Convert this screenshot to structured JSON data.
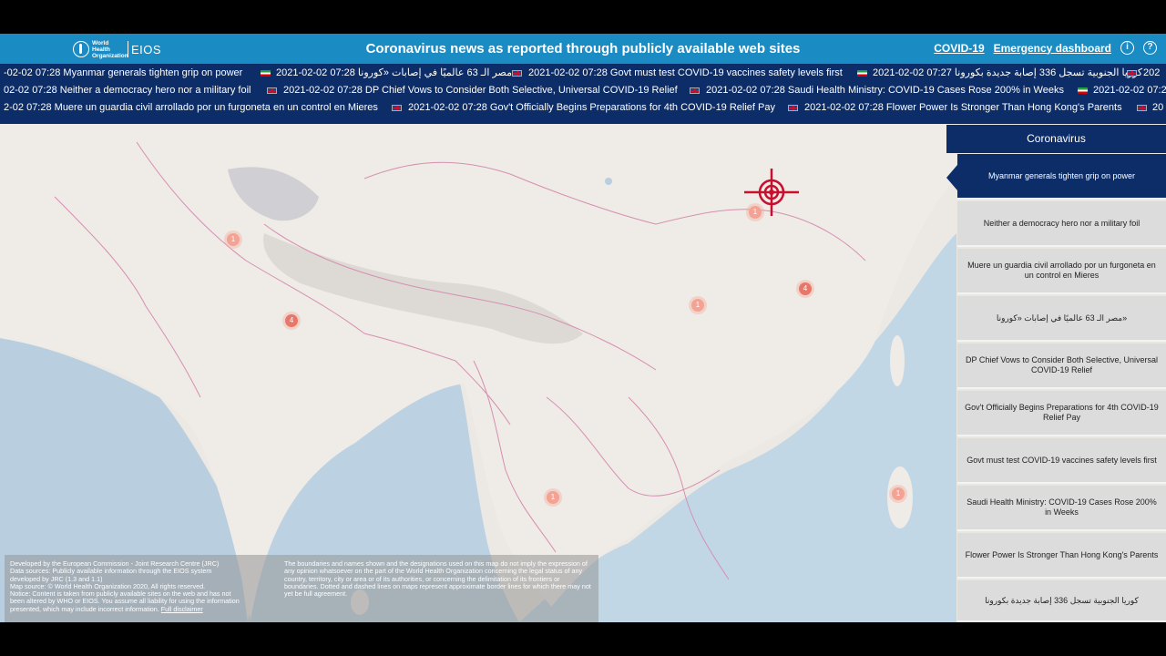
{
  "header": {
    "logo_org": "World Health Organization",
    "logo_product": "EIOS",
    "title": "Coronavirus news as reported through publicly available web sites",
    "nav_covid": "COVID-19",
    "nav_dashboard": "Emergency dashboard",
    "info_icon": "info-icon",
    "help_icon": "help-icon",
    "info_glyph": "i",
    "help_glyph": "?"
  },
  "ticker": {
    "rows": [
      [
        {
          "text": "-02-02 07:28  Myanmar generals tighten grip on power"
        },
        {
          "text": "2021-02-02 07:28  مصر الـ 63 عالميًا في إصابات «كورونا»"
        },
        {
          "text": "2021-02-02 07:28  Govt must test COVID-19 vaccines safety levels first"
        },
        {
          "text": "2021-02-02 07:27  كوريا الجنوبية تسجل 336 إصابة جديدة بكورونا"
        },
        {
          "text": "202"
        }
      ],
      [
        {
          "text": "02-02 07:28  Neither a democracy hero nor a military foil"
        },
        {
          "text": "2021-02-02 07:28  DP Chief Vows to Consider Both Selective, Universal COVID-19 Relief"
        },
        {
          "text": "2021-02-02 07:28  Saudi Health Ministry: COVID-19 Cases Rose 200% in Weeks"
        },
        {
          "text": "2021-02-02 07:2"
        }
      ],
      [
        {
          "text": "2-02 07:28  Muere un guardia civil arrollado por un furgoneta en un control en Mieres"
        },
        {
          "text": "2021-02-02 07:28  Gov't Officially Begins Preparations for 4th COVID-19 Relief Pay"
        },
        {
          "text": "2021-02-02 07:28  Flower Power Is Stronger Than Hong Kong's Parents"
        },
        {
          "text": "20"
        }
      ]
    ]
  },
  "map": {
    "clusters": [
      {
        "label": "1"
      },
      {
        "label": "4"
      },
      {
        "label": "1"
      },
      {
        "label": "4"
      },
      {
        "label": "1"
      },
      {
        "label": "1"
      },
      {
        "label": "1"
      }
    ],
    "target_icon": "crosshair-target-icon"
  },
  "footer": {
    "left_lines": [
      "Developed by the European Commission - Joint Research Centre (JRC)",
      "Data sources: Publicly available information through the EIOS system",
      "developed by JRC (1.3 and 1.1)",
      "Map source: © World Health Organization 2020, All rights reserved.",
      "Notice: Content is taken from publicly available sites on the web and has not",
      "been altered by WHO or EIOS. You assume all liability for using the information",
      "presented, which may include incorrect information."
    ],
    "disclaimer_link": "Full disclaimer",
    "right_text": "The boundaries and names shown and the designations used on this map do not imply the expression of any opinion whatsoever on the part of the World Health Organization concerning the legal status of any country, territory, city or area or of its authorities, or concerning the delimitation of its frontiers or boundaries. Dotted and dashed lines on maps represent approximate border lines for which there may not yet be full agreement."
  },
  "sidebar": {
    "title": "Coronavirus",
    "items": [
      {
        "label": "Myanmar generals tighten grip on power"
      },
      {
        "label": "Neither a democracy hero nor a military foil"
      },
      {
        "label": "Muere un guardia civil arrollado por un furgoneta en un control en Mieres"
      },
      {
        "label": "مصر الـ 63 عالميًا في إصابات «كورونا»"
      },
      {
        "label": "DP Chief Vows to Consider Both Selective, Universal COVID-19 Relief"
      },
      {
        "label": "Gov't Officially Begins Preparations for 4th COVID-19 Relief Pay"
      },
      {
        "label": "Govt must test COVID-19 vaccines safety levels first"
      },
      {
        "label": "Saudi Health Ministry: COVID-19 Cases Rose 200% in Weeks"
      },
      {
        "label": "Flower Power Is Stronger Than Hong Kong's Parents"
      },
      {
        "label": "كوريا الجنوبية تسجل 336 إصابة جديدة بكورونا"
      }
    ]
  },
  "colors": {
    "header_bg": "#1a8bc3",
    "ticker_bg": "#0c2d68",
    "cluster": "#f4a293",
    "target": "#c8102e"
  }
}
